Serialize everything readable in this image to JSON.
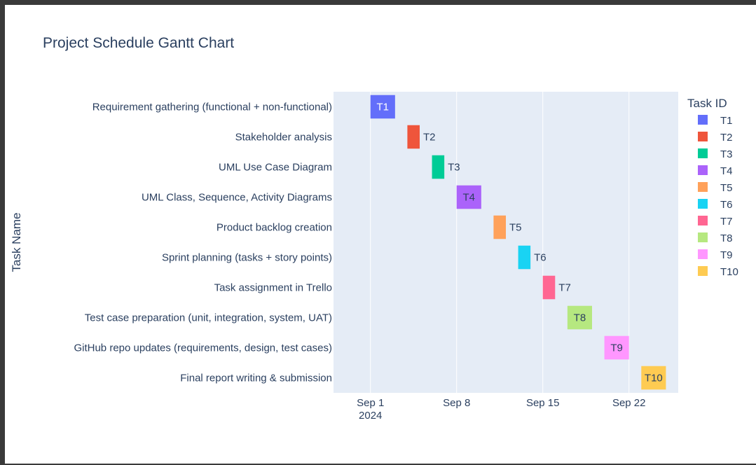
{
  "chart_data": {
    "type": "gantt",
    "title": "Project Schedule Gantt Chart",
    "xlabel": "",
    "ylabel": "Task Name",
    "legend_title": "Task ID",
    "legend_position": "right",
    "x_range": [
      "2024-08-29",
      "2024-09-26"
    ],
    "x_ticks": [
      {
        "date": "2024-09-01",
        "label": "Sep 1",
        "sublabel": "2024"
      },
      {
        "date": "2024-09-08",
        "label": "Sep 8",
        "sublabel": ""
      },
      {
        "date": "2024-09-15",
        "label": "Sep 15",
        "sublabel": ""
      },
      {
        "date": "2024-09-22",
        "label": "Sep 22",
        "sublabel": ""
      }
    ],
    "tasks": [
      {
        "id": "T1",
        "name": "Requirement gathering (functional + non-functional)",
        "start": "2024-09-01",
        "end": "2024-09-03",
        "color": "#636efa",
        "label_inside": true
      },
      {
        "id": "T2",
        "name": "Stakeholder analysis",
        "start": "2024-09-04",
        "end": "2024-09-05",
        "color": "#ef553b",
        "label_inside": false
      },
      {
        "id": "T3",
        "name": "UML Use Case Diagram",
        "start": "2024-09-06",
        "end": "2024-09-07",
        "color": "#00cc96",
        "label_inside": false
      },
      {
        "id": "T4",
        "name": "UML Class, Sequence, Activity Diagrams",
        "start": "2024-09-08",
        "end": "2024-09-10",
        "color": "#ab63fa",
        "label_inside": true
      },
      {
        "id": "T5",
        "name": "Product backlog creation",
        "start": "2024-09-11",
        "end": "2024-09-12",
        "color": "#ffa15a",
        "label_inside": false
      },
      {
        "id": "T6",
        "name": "Sprint planning (tasks + story points)",
        "start": "2024-09-13",
        "end": "2024-09-14",
        "color": "#19d3f3",
        "label_inside": false
      },
      {
        "id": "T7",
        "name": "Task assignment in Trello",
        "start": "2024-09-15",
        "end": "2024-09-16",
        "color": "#ff6692",
        "label_inside": false
      },
      {
        "id": "T8",
        "name": "Test case preparation (unit, integration, system, UAT)",
        "start": "2024-09-17",
        "end": "2024-09-19",
        "color": "#b6e880",
        "label_inside": true
      },
      {
        "id": "T9",
        "name": "GitHub repo updates (requirements, design, test cases)",
        "start": "2024-09-20",
        "end": "2024-09-22",
        "color": "#ff97ff",
        "label_inside": true
      },
      {
        "id": "T10",
        "name": "Final report writing & submission",
        "start": "2024-09-23",
        "end": "2024-09-25",
        "color": "#fecb52",
        "label_inside": true
      }
    ]
  }
}
